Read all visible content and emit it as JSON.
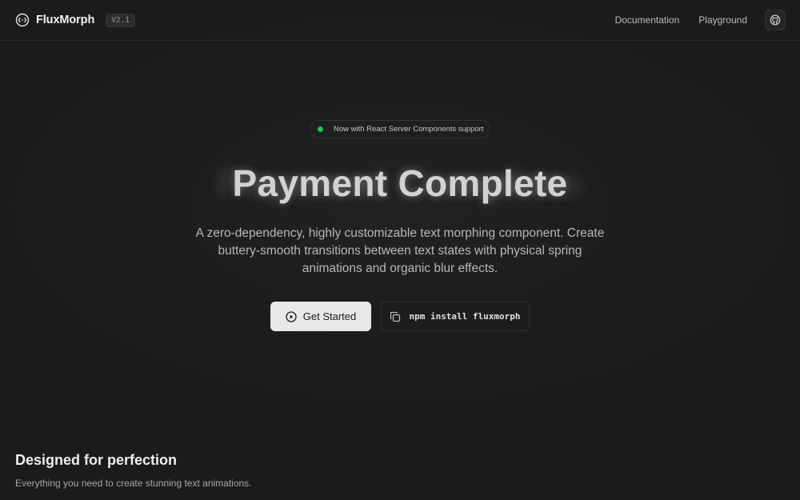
{
  "header": {
    "brand": "FluxMorph",
    "version": "V2.1",
    "nav": [
      {
        "label": "Documentation"
      },
      {
        "label": "Playground"
      }
    ],
    "github_icon": "github-icon",
    "brand_icon": "morph-logo-icon"
  },
  "hero": {
    "badge_text": "Now with React Server Components support",
    "badge_dot_color": "#22c55e",
    "title": "Payment Complete",
    "description": "A zero-dependency, highly customizable text morphing component. Create buttery-smooth transitions between text states with physical spring animations and organic blur effects.",
    "primary_button": "Get Started",
    "primary_icon": "play-circle-icon",
    "install_command": "npm install fluxmorph",
    "copy_icon": "copy-icon"
  },
  "features": {
    "title": "Designed for perfection",
    "subtitle": "Everything you need to create stunning text animations."
  },
  "colors": {
    "background": "#1b1b1b",
    "primary_button_bg": "#e8e8e8",
    "accent_green": "#22c55e"
  }
}
